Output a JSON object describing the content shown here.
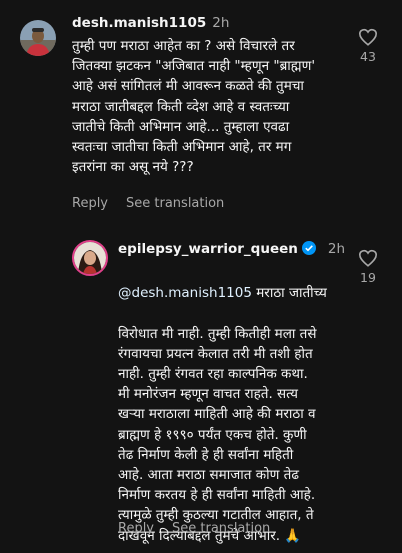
{
  "comments": [
    {
      "username": "desh.manish1105",
      "time": "2h",
      "text": "तुम्ही पण मराठा आहेत का ? असे विचारले तर\nजितक्या झटकन \"अजिबात नाही \"म्हणून \"ब्राह्मण'\nआहे असं सांगितलं मी आवरून कळते की तुमचा\nमराठा जातीबद्दल किती व्देश आहे व स्वतःच्या\nजातीचे किती अभिमान आहे... तुम्हाला एवढा\nस्वतःचा जातीचा किती अभिमान आहे, तर मग\nइतरांना का असू नये ???",
      "likes": "43",
      "reply_label": "Reply",
      "translate_label": "See translation",
      "like_icon": "heart-outline-icon"
    },
    {
      "username": "epilepsy_warrior_queen",
      "verified": true,
      "time": "2h",
      "mention": "@desh.manish1105",
      "text_first": " मराठा जातीच्य",
      "text": "विरोधात मी नाही. तुम्ही कितीही मला तसे\nरंगवायचा प्रयत्न केलात तरी मी तशी होत\nनाही. तुम्ही रंगवत रहा काल्पनिक कथा.\nमी मनोरंजन म्हणून वाचत राहते. सत्य\nखऱ्या मराठाला माहिती आहे की मराठा व\nब्राह्मण हे १९९० पर्यंत एकच होते. कुणी\nतेढ निर्माण केली हे ही सर्वांना महिती\nआहे. आता मराठा समाजात कोण तेढ\nनिर्माण करतय हे ही सर्वांना माहिती आहे.\nत्यामुळे तुम्ही कुठल्या गटातील आहात, ते\nदाखवून दिल्याबद्दल तुमचे आभार. 🙏",
      "likes": "19",
      "reply_label": "Reply",
      "translate_label": "See translation",
      "like_icon": "heart-outline-icon"
    }
  ],
  "colors": {
    "background": "#131313",
    "text": "#f5f5f5",
    "muted": "#a8a8a8",
    "verified": "#0095f6"
  }
}
